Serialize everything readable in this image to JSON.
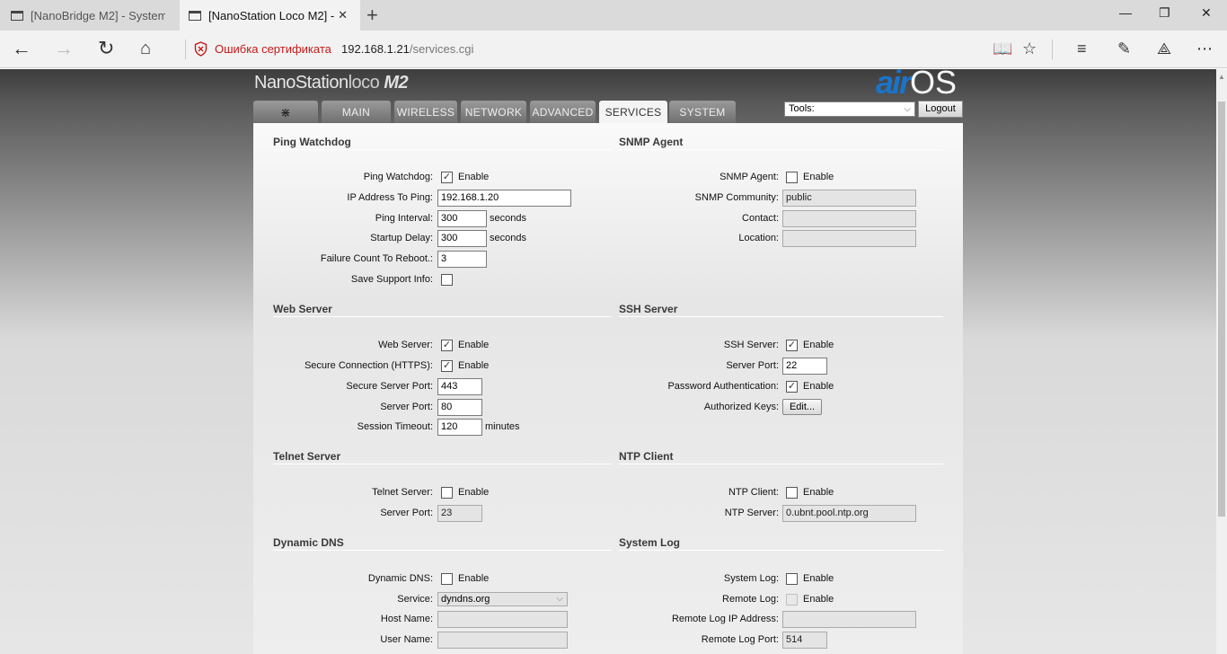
{
  "browser": {
    "tabs": [
      {
        "label": "[NanoBridge M2] - System"
      },
      {
        "label": "[NanoStation Loco M2] -"
      }
    ],
    "cert_warning": "Ошибка сертификата",
    "url_host": "192.168.1.21",
    "url_path": "/services.cgi"
  },
  "header": {
    "brand_main": "NanoStation",
    "brand_loco": "loco",
    "brand_model": "M2",
    "logo_air": "air",
    "logo_os": "OS",
    "tabs": [
      "MAIN",
      "WIRELESS",
      "NETWORK",
      "ADVANCED",
      "SERVICES",
      "SYSTEM"
    ],
    "active_tab": "SERVICES",
    "tools_value": "Tools:",
    "logout_label": "Logout"
  },
  "sections": {
    "ping_watchdog": {
      "title": "Ping Watchdog",
      "enable_label": "Ping Watchdog:",
      "enable_text": "Enable",
      "enable_checked": true,
      "ip_label": "IP Address To Ping:",
      "ip_value": "192.168.1.20",
      "interval_label": "Ping Interval:",
      "interval_value": "300",
      "interval_unit": "seconds",
      "delay_label": "Startup Delay:",
      "delay_value": "300",
      "delay_unit": "seconds",
      "failure_label": "Failure Count To Reboot.:",
      "failure_value": "3",
      "support_label": "Save Support Info:",
      "support_checked": false
    },
    "snmp_agent": {
      "title": "SNMP Agent",
      "enable_label": "SNMP Agent:",
      "enable_text": "Enable",
      "enable_checked": false,
      "community_label": "SNMP Community:",
      "community_value": "public",
      "contact_label": "Contact:",
      "contact_value": "",
      "location_label": "Location:",
      "location_value": ""
    },
    "web_server": {
      "title": "Web Server",
      "enable_label": "Web Server:",
      "enable_text": "Enable",
      "enable_checked": true,
      "https_label": "Secure Connection (HTTPS):",
      "https_text": "Enable",
      "https_checked": true,
      "secure_port_label": "Secure Server Port:",
      "secure_port_value": "443",
      "port_label": "Server Port:",
      "port_value": "80",
      "timeout_label": "Session Timeout:",
      "timeout_value": "120",
      "timeout_unit": "minutes"
    },
    "ssh_server": {
      "title": "SSH Server",
      "enable_label": "SSH Server:",
      "enable_text": "Enable",
      "enable_checked": true,
      "port_label": "Server Port:",
      "port_value": "22",
      "pwauth_label": "Password Authentication:",
      "pwauth_text": "Enable",
      "pwauth_checked": true,
      "keys_label": "Authorized Keys:",
      "keys_button": "Edit..."
    },
    "telnet_server": {
      "title": "Telnet Server",
      "enable_label": "Telnet Server:",
      "enable_text": "Enable",
      "enable_checked": false,
      "port_label": "Server Port:",
      "port_value": "23"
    },
    "ntp_client": {
      "title": "NTP Client",
      "enable_label": "NTP Client:",
      "enable_text": "Enable",
      "enable_checked": false,
      "server_label": "NTP Server:",
      "server_value": "0.ubnt.pool.ntp.org"
    },
    "dynamic_dns": {
      "title": "Dynamic DNS",
      "enable_label": "Dynamic DNS:",
      "enable_text": "Enable",
      "enable_checked": false,
      "service_label": "Service:",
      "service_value": "dyndns.org",
      "host_label": "Host Name:",
      "host_value": "",
      "user_label": "User Name:",
      "user_value": ""
    },
    "system_log": {
      "title": "System Log",
      "enable_label": "System Log:",
      "enable_text": "Enable",
      "enable_checked": false,
      "remote_label": "Remote Log:",
      "remote_text": "Enable",
      "remote_checked": false,
      "remote_ip_label": "Remote Log IP Address:",
      "remote_ip_value": "",
      "remote_port_label": "Remote Log Port:",
      "remote_port_value": "514"
    }
  }
}
